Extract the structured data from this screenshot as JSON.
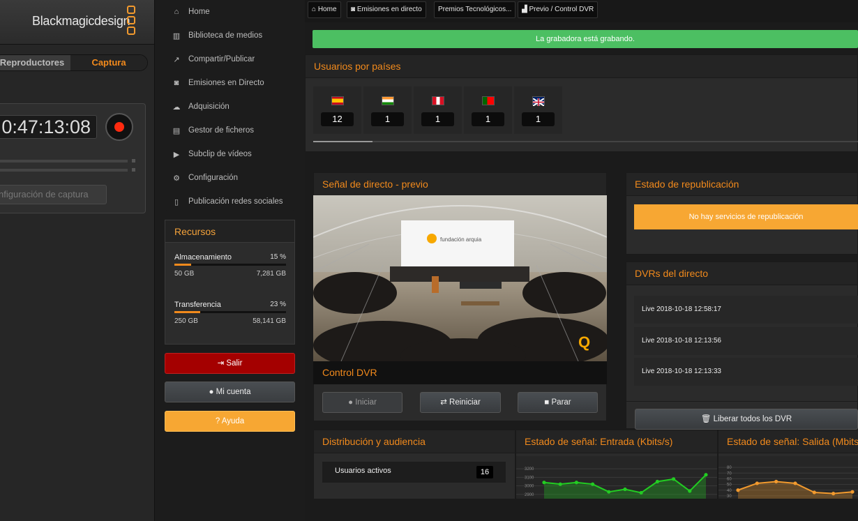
{
  "blackmagic": {
    "logo_text": "Blackmagicdesign",
    "tabs": [
      "Reproductores",
      "Captura"
    ],
    "active_tab": "Captura",
    "timecode": "0:47:13:08",
    "config_button": "nfiguración de captura",
    "accent_color": "#f28a1c"
  },
  "sidebar": {
    "items": [
      {
        "label": "Home",
        "icon": "home-icon"
      },
      {
        "label": "Biblioteca de medios",
        "icon": "library-icon"
      },
      {
        "label": "Compartir/Publicar",
        "icon": "share-icon"
      },
      {
        "label": "Emisiones en Directo",
        "icon": "camera-icon"
      },
      {
        "label": "Adquisición",
        "icon": "cloud-icon"
      },
      {
        "label": "Gestor de ficheros",
        "icon": "file-icon"
      },
      {
        "label": "Subclip de vídeos",
        "icon": "video-icon"
      },
      {
        "label": "Configuración",
        "icon": "gear-icon"
      },
      {
        "label": "Publicación redes sociales",
        "icon": "mobile-icon"
      }
    ]
  },
  "resources": {
    "title": "Recursos",
    "storage": {
      "label": "Almacenamiento",
      "percent_text": "15 %",
      "percent": 15,
      "used": "50 GB",
      "total": "7,281 GB"
    },
    "transfer": {
      "label": "Transferencia",
      "percent_text": "23 %",
      "percent": 23,
      "used": "250 GB",
      "total": "58,141 GB"
    }
  },
  "account": {
    "logout": "Salir",
    "my_account": "Mi cuenta",
    "help": "Ayuda"
  },
  "breadcrumb": [
    "Home",
    "Emisiones en directo",
    "Premios Tecnológicos...",
    "Previo / Control DVR"
  ],
  "alert": "La grabadora está grabando.",
  "users_by_country": {
    "title": "Usuarios por países",
    "countries": [
      {
        "code": "es",
        "count": "12"
      },
      {
        "code": "in",
        "count": "1"
      },
      {
        "code": "pe",
        "count": "1"
      },
      {
        "code": "pt",
        "count": "1"
      },
      {
        "code": "gb",
        "count": "1"
      }
    ]
  },
  "live_preview": {
    "title": "Señal de directo - previo",
    "stage_text": "fundación arquia",
    "dvr_control_title": "Control DVR",
    "buttons": {
      "start": "Iniciar",
      "restart": "Reiniciar",
      "stop": "Parar"
    }
  },
  "republish": {
    "title": "Estado de republicación",
    "message": "No hay servicios de republicación",
    "warn_color": "#f7a733"
  },
  "dvrs": {
    "title": "DVRs del directo",
    "items": [
      "Live 2018-10-18 12:58:17",
      "Live 2018-10-18 12:13:56",
      "Live 2018-10-18 12:13:33"
    ],
    "release_all": "Liberar todos los DVR"
  },
  "distribution": {
    "title": "Distribución y audiencia",
    "active_users_label": "Usuarios activos",
    "active_users_value": "16"
  },
  "chart_data": [
    {
      "type": "area",
      "title": "Estado de señal: Entrada (Kbits/s)",
      "ticks": [
        "3200",
        "3100",
        "3000",
        "2900"
      ],
      "ylim": [
        2850,
        3250
      ],
      "values": [
        3040,
        3020,
        3040,
        3020,
        2930,
        2960,
        2920,
        3050,
        3080,
        2940,
        3130
      ],
      "color": "#22cc22"
    },
    {
      "type": "area",
      "title": "Estado de señal: Salida (Mbits/s)",
      "ticks": [
        "80",
        "70",
        "60",
        "50",
        "40",
        "30"
      ],
      "ylim": [
        25,
        85
      ],
      "values": [
        40,
        52,
        55,
        52,
        36,
        34,
        37
      ],
      "color": "#f29a2e"
    }
  ]
}
